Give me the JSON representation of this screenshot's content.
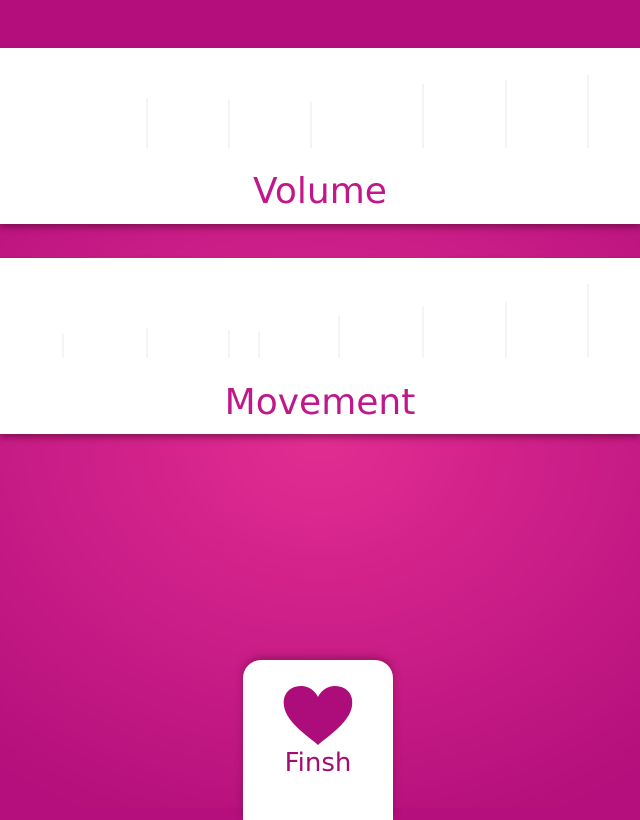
{
  "theme": {
    "accent": "#c0188a",
    "background": "#d0228a",
    "panel": "#ffffff",
    "heart": "#ac0d7a"
  },
  "volume": {
    "label": "Volume"
  },
  "movement": {
    "label": "Movement"
  },
  "finish": {
    "label": "Finsh",
    "icon": "heart-icon"
  }
}
